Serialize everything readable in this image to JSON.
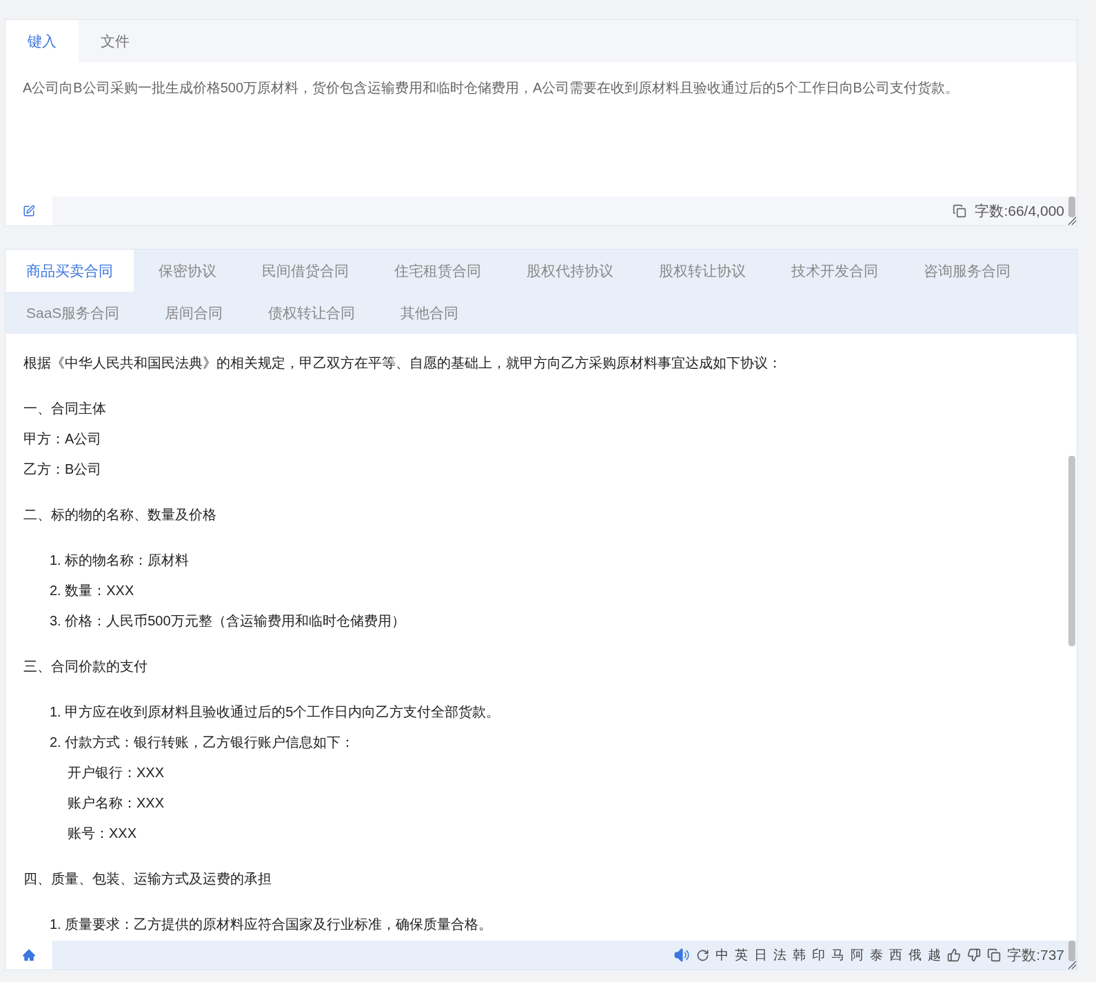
{
  "input_tabs": [
    {
      "label": "键入",
      "selected": true
    },
    {
      "label": "文件",
      "selected": false
    }
  ],
  "input_text": "A公司向B公司采购一批生成价格500万原材料，货价包含运输费用和临时仓储费用，A公司需要在收到原材料且验收通过后的5个工作日向B公司支付货款。",
  "input_count": "字数:66/4,000",
  "contract_tabs": [
    {
      "label": "商品买卖合同",
      "selected": true
    },
    {
      "label": "保密协议",
      "selected": false
    },
    {
      "label": "民间借贷合同",
      "selected": false
    },
    {
      "label": "住宅租赁合同",
      "selected": false
    },
    {
      "label": "股权代持协议",
      "selected": false
    },
    {
      "label": "股权转让协议",
      "selected": false
    },
    {
      "label": "技术开发合同",
      "selected": false
    },
    {
      "label": "咨询服务合同",
      "selected": false
    },
    {
      "label": "SaaS服务合同",
      "selected": false
    },
    {
      "label": "居间合同",
      "selected": false
    },
    {
      "label": "债权转让合同",
      "selected": false
    },
    {
      "label": "其他合同",
      "selected": false
    }
  ],
  "contract_blocks": [
    [
      {
        "kind": "line",
        "text": "根据《中华人民共和国民法典》的相关规定，甲乙双方在平等、自愿的基础上，就甲方向乙方采购原材料事宜达成如下协议："
      }
    ],
    [
      {
        "kind": "line",
        "text": "一、合同主体"
      },
      {
        "kind": "line",
        "text": "甲方：A公司"
      },
      {
        "kind": "line",
        "text": "乙方：B公司"
      }
    ],
    [
      {
        "kind": "line",
        "text": "二、标的物的名称、数量及价格"
      }
    ],
    [
      {
        "kind": "item",
        "text": "1. 标的物名称：原材料"
      },
      {
        "kind": "item",
        "text": "2. 数量：XXX"
      },
      {
        "kind": "item",
        "text": "3. 价格：人民币500万元整（含运输费用和临时仓储费用）"
      }
    ],
    [
      {
        "kind": "line",
        "text": "三、合同价款的支付"
      }
    ],
    [
      {
        "kind": "item",
        "text": "1. 甲方应在收到原材料且验收通过后的5个工作日内向乙方支付全部货款。"
      },
      {
        "kind": "item",
        "text": "2. 付款方式：银行转账，乙方银行账户信息如下："
      },
      {
        "kind": "sub",
        "text": "开户银行：XXX"
      },
      {
        "kind": "sub",
        "text": "账户名称：XXX"
      },
      {
        "kind": "sub",
        "text": "账号：XXX"
      }
    ],
    [
      {
        "kind": "line",
        "text": "四、质量、包装、运输方式及运费的承担"
      }
    ],
    [
      {
        "kind": "item",
        "text": "1. 质量要求：乙方提供的原材料应符合国家及行业标准，确保质量合格。"
      }
    ]
  ],
  "languages": [
    "中",
    "英",
    "日",
    "法",
    "韩",
    "印",
    "马",
    "阿",
    "泰",
    "西",
    "俄",
    "越"
  ],
  "output_count": "字数:737"
}
